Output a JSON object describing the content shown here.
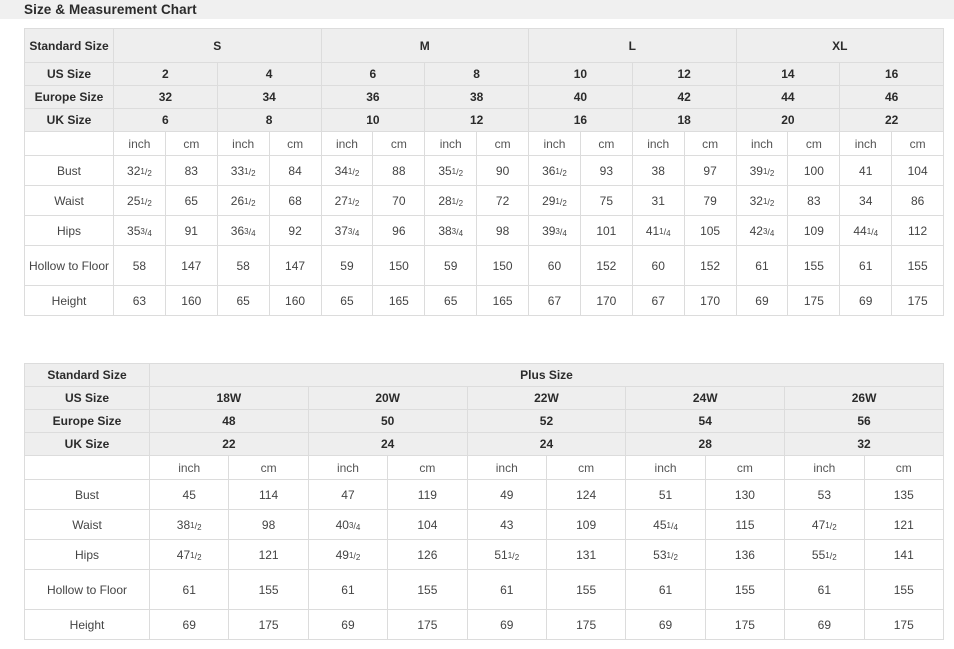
{
  "header": {
    "title": "Size & Measurement Chart"
  },
  "standard_table": {
    "std_label": "Standard Size",
    "size_groups": [
      {
        "label": "S",
        "span": 4
      },
      {
        "label": "M",
        "span": 4
      },
      {
        "label": "L",
        "span": 4
      },
      {
        "label": "XL",
        "span": 4
      }
    ],
    "rows_header": [
      {
        "label": "US Size",
        "values": [
          "2",
          "4",
          "6",
          "8",
          "10",
          "12",
          "14",
          "16"
        ]
      },
      {
        "label": "Europe Size",
        "values": [
          "32",
          "34",
          "36",
          "38",
          "40",
          "42",
          "44",
          "46"
        ]
      },
      {
        "label": "UK Size",
        "values": [
          "6",
          "8",
          "10",
          "12",
          "16",
          "18",
          "20",
          "22"
        ]
      }
    ],
    "unit_labels": [
      "inch",
      "cm",
      "inch",
      "cm",
      "inch",
      "cm",
      "inch",
      "cm",
      "inch",
      "cm",
      "inch",
      "cm",
      "inch",
      "cm",
      "inch",
      "cm"
    ],
    "measure_rows": [
      {
        "label": "Bust",
        "values": [
          "32 1/2",
          "83",
          "33 1/2",
          "84",
          "34 1/2",
          "88",
          "35 1/2",
          "90",
          "36 1/2",
          "93",
          "38",
          "97",
          "39 1/2",
          "100",
          "41",
          "104"
        ]
      },
      {
        "label": "Waist",
        "values": [
          "25 1/2",
          "65",
          "26 1/2",
          "68",
          "27 1/2",
          "70",
          "28 1/2",
          "72",
          "29 1/2",
          "75",
          "31",
          "79",
          "32 1/2",
          "83",
          "34",
          "86"
        ]
      },
      {
        "label": "Hips",
        "values": [
          "35 3/4",
          "91",
          "36 3/4",
          "92",
          "37 3/4",
          "96",
          "38 3/4",
          "98",
          "39 3/4",
          "101",
          "41 1/4",
          "105",
          "42 3/4",
          "109",
          "44 1/4",
          "112"
        ]
      },
      {
        "label": "Hollow to Floor",
        "tall": true,
        "values": [
          "58",
          "147",
          "58",
          "147",
          "59",
          "150",
          "59",
          "150",
          "60",
          "152",
          "60",
          "152",
          "61",
          "155",
          "61",
          "155"
        ]
      },
      {
        "label": "Height",
        "values": [
          "63",
          "160",
          "65",
          "160",
          "65",
          "165",
          "65",
          "165",
          "67",
          "170",
          "67",
          "170",
          "69",
          "175",
          "69",
          "175"
        ]
      }
    ]
  },
  "plus_table": {
    "std_label": "Standard Size",
    "group_label": "Plus Size",
    "rows_header": [
      {
        "label": "US Size",
        "values": [
          "18W",
          "20W",
          "22W",
          "24W",
          "26W"
        ]
      },
      {
        "label": "Europe Size",
        "values": [
          "48",
          "50",
          "52",
          "54",
          "56"
        ]
      },
      {
        "label": "UK Size",
        "values": [
          "22",
          "24",
          "24",
          "28",
          "32"
        ]
      }
    ],
    "unit_labels": [
      "inch",
      "cm",
      "inch",
      "cm",
      "inch",
      "cm",
      "inch",
      "cm",
      "inch",
      "cm"
    ],
    "measure_rows": [
      {
        "label": "Bust",
        "values": [
          "45",
          "114",
          "47",
          "119",
          "49",
          "124",
          "51",
          "130",
          "53",
          "135"
        ]
      },
      {
        "label": "Waist",
        "values": [
          "38 1/2",
          "98",
          "40 3/4",
          "104",
          "43",
          "109",
          "45 1/4",
          "115",
          "47 1/2",
          "121"
        ]
      },
      {
        "label": "Hips",
        "values": [
          "47 1/2",
          "121",
          "49 1/2",
          "126",
          "51 1/2",
          "131",
          "53 1/2",
          "136",
          "55 1/2",
          "141"
        ]
      },
      {
        "label": "Hollow to Floor",
        "tall": true,
        "values": [
          "61",
          "155",
          "61",
          "155",
          "61",
          "155",
          "61",
          "155",
          "61",
          "155"
        ]
      },
      {
        "label": "Height",
        "values": [
          "69",
          "175",
          "69",
          "175",
          "69",
          "175",
          "69",
          "175",
          "69",
          "175"
        ]
      }
    ]
  },
  "colors": {
    "header_band": "#eeeeee",
    "title_bar": "#f0f0f0",
    "border": "#dcdcdc",
    "text": "#444444",
    "title_text": "#2b2b2b"
  }
}
